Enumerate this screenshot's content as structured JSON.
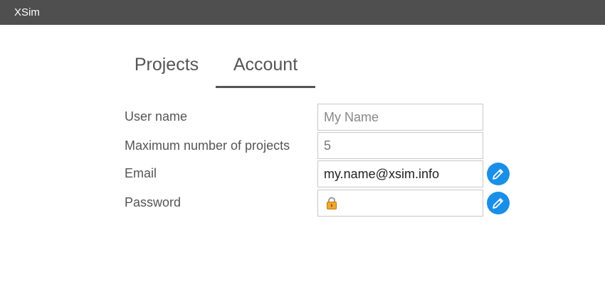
{
  "app": {
    "title": "XSim"
  },
  "tabs": [
    {
      "label": "Projects",
      "active": false
    },
    {
      "label": "Account",
      "active": true
    }
  ],
  "form": {
    "username": {
      "label": "User name",
      "placeholder": "My Name",
      "value": ""
    },
    "max_projects": {
      "label": "Maximum number of projects",
      "value": "5"
    },
    "email": {
      "label": "Email",
      "value": "my.name@xsim.info"
    },
    "password": {
      "label": "Password",
      "value": ""
    }
  },
  "colors": {
    "titlebar": "#4f4f4f",
    "accent": "#1a8fe8",
    "text": "#555555"
  },
  "icons": {
    "email_edit": "pencil-icon",
    "password_edit": "pencil-icon",
    "password_lock": "lock-icon"
  }
}
